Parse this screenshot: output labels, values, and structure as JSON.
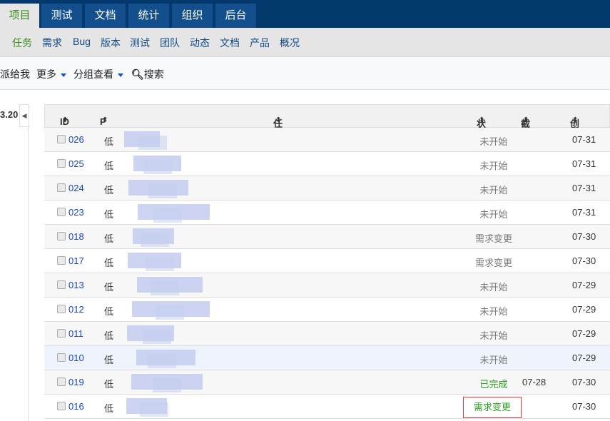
{
  "topnav": {
    "tabs": [
      {
        "label": "项目",
        "active": true
      },
      {
        "label": "测试"
      },
      {
        "label": "文档"
      },
      {
        "label": "统计"
      },
      {
        "label": "组织"
      },
      {
        "label": "后台"
      }
    ]
  },
  "subnav": {
    "items": [
      "任务",
      "需求",
      "Bug",
      "版本",
      "测试",
      "团队",
      "动态",
      "文档",
      "产品",
      "概况"
    ],
    "active": "任务"
  },
  "toolbar": {
    "assigned": "派给我",
    "more": "更多",
    "group": "分组查看",
    "search": "搜索"
  },
  "leftpane": {
    "label": "3.20"
  },
  "table": {
    "headers": {
      "id": "ID",
      "pri": "P",
      "name": "任务名称",
      "status": "状态",
      "deadline": "截止",
      "created": "创建"
    },
    "rows": [
      {
        "id": "026",
        "pri": "低",
        "status": "未开始",
        "deadline": "",
        "created": "07-31"
      },
      {
        "id": "025",
        "pri": "低",
        "status": "未开始",
        "deadline": "",
        "created": "07-31"
      },
      {
        "id": "024",
        "pri": "低",
        "status": "未开始",
        "deadline": "",
        "created": "07-31"
      },
      {
        "id": "023",
        "pri": "低",
        "status": "未开始",
        "deadline": "",
        "created": "07-31"
      },
      {
        "id": "018",
        "pri": "低",
        "status": "需求变更",
        "deadline": "",
        "created": "07-30"
      },
      {
        "id": "017",
        "pri": "低",
        "status": "需求变更",
        "deadline": "",
        "created": "07-30"
      },
      {
        "id": "013",
        "pri": "低",
        "status": "未开始",
        "deadline": "",
        "created": "07-29"
      },
      {
        "id": "012",
        "pri": "低",
        "status": "未开始",
        "deadline": "",
        "created": "07-29"
      },
      {
        "id": "011",
        "pri": "低",
        "status": "未开始",
        "deadline": "",
        "created": "07-29"
      },
      {
        "id": "010",
        "pri": "低",
        "status": "未开始",
        "deadline": "",
        "created": "07-29"
      },
      {
        "id": "019",
        "pri": "低",
        "status": "已完成",
        "deadline": "07-28",
        "created": "07-30"
      },
      {
        "id": "016",
        "pri": "低",
        "status": "需求变更",
        "deadline": "",
        "created": "07-30"
      }
    ]
  },
  "colors": {
    "nav": "#03396c",
    "tab": "#134f8c",
    "active": "#3a8a1d",
    "link": "#1a44c0",
    "highlight_box": "#ee3333"
  }
}
